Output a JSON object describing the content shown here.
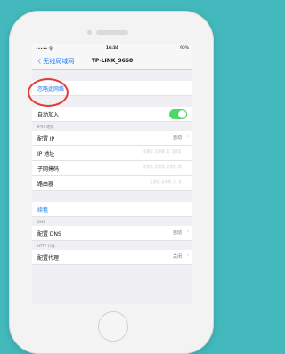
{
  "status": {
    "left": "••••• 令",
    "time": "16:34",
    "right": "90%"
  },
  "nav": {
    "back": "〈 无线局域网",
    "title": "TP-LINK_9668"
  },
  "rows": {
    "forget": "忽略此网络",
    "auto_join": "自动加入",
    "ipv4_header": "IPV4 地址",
    "config_ip": "配置 IP",
    "config_ip_value": "自动",
    "ip": "IP 地址",
    "ip_value": "192.168.1.101",
    "mask": "子网掩码",
    "mask_value": "255.255.255.0",
    "router": "路由器",
    "router_value": "192.168.1.1",
    "renew": "续租",
    "dns_header": "DNS",
    "config_dns": "配置 DNS",
    "config_dns_value": "自动",
    "proxy_header": "HTTP 代理",
    "config_proxy": "配置代理",
    "config_proxy_value": "关闭"
  },
  "colors": {
    "background": "#43b9bd",
    "accent": "#1b7cf6",
    "toggle": "#4cd964",
    "highlight": "#e53a3a"
  }
}
